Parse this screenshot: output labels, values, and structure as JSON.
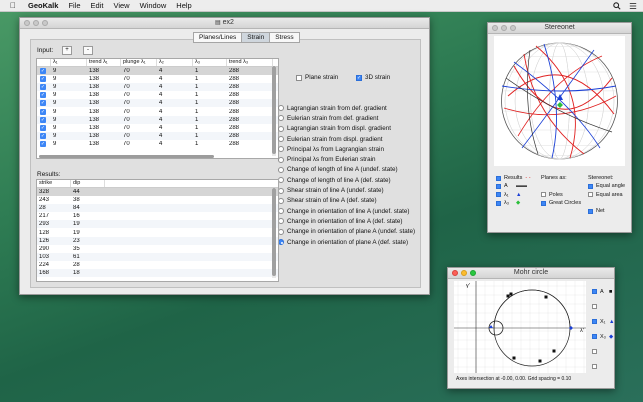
{
  "menubar": {
    "apple": "",
    "app": "GeoKalk",
    "items": [
      "File",
      "Edit",
      "View",
      "Window",
      "Help"
    ]
  },
  "main": {
    "title": "ex2",
    "tabs": [
      "Planes/Lines",
      "Strain",
      "Stress"
    ],
    "active_tab": "Strain",
    "input_label": "Input:",
    "add_label": "+",
    "remove_label": "-",
    "input_columns": [
      "",
      "λ₁",
      "trend λ₁",
      "plunge λ₁",
      "λ₂",
      "λ₃",
      "trend λ₃"
    ],
    "input_rows": [
      [
        "9",
        "138",
        "70",
        "4",
        "1",
        "288"
      ],
      [
        "9",
        "138",
        "70",
        "4",
        "1",
        "288"
      ],
      [
        "9",
        "138",
        "70",
        "4",
        "1",
        "288"
      ],
      [
        "9",
        "138",
        "70",
        "4",
        "1",
        "288"
      ],
      [
        "9",
        "138",
        "70",
        "4",
        "1",
        "288"
      ],
      [
        "9",
        "138",
        "70",
        "4",
        "1",
        "288"
      ],
      [
        "9",
        "138",
        "70",
        "4",
        "1",
        "288"
      ],
      [
        "9",
        "138",
        "70",
        "4",
        "1",
        "288"
      ],
      [
        "9",
        "138",
        "70",
        "4",
        "1",
        "288"
      ],
      [
        "9",
        "138",
        "70",
        "4",
        "1",
        "288"
      ]
    ],
    "plane_strain_label": "Plane strain",
    "strain3d_label": "3D strain",
    "options": [
      "Lagrangian strain from def. gradient",
      "Eulerian strain from def. gradient",
      "Lagrangian strain from displ. gradient",
      "Eulerian strain from displ. gradient",
      "Principal λs from Lagrangian strain",
      "Principal λs from Eulerian strain",
      "Change of length of line A (undef. state)",
      "Change of length of line A (def. state)",
      "Shear strain of line A (undef. state)",
      "Shear strain of line A (def. state)",
      "Change in orientation of line A (undef. state)",
      "Change in orientation of line A (def. state)",
      "Change in orientation of plane A (undef. state)",
      "Change in orientation of plane A (def. state)"
    ],
    "selected_option_index": 13,
    "results_label": "Results:",
    "results_columns": [
      "strike",
      "dip"
    ],
    "results_rows": [
      [
        "328",
        "44"
      ],
      [
        "243",
        "38"
      ],
      [
        "28",
        "84"
      ],
      [
        "217",
        "16"
      ],
      [
        "293",
        "19"
      ],
      [
        "128",
        "19"
      ],
      [
        "126",
        "23"
      ],
      [
        "290",
        "35"
      ],
      [
        "103",
        "61"
      ],
      [
        "224",
        "28"
      ],
      [
        "168",
        "18"
      ]
    ]
  },
  "stereonet": {
    "title": "Stereonet",
    "results_label": "Results",
    "legend": [
      {
        "label": "A",
        "color": "#444444"
      },
      {
        "label": "λ₁",
        "color": "#1a3fd6"
      },
      {
        "label": "λ₃",
        "color": "#2bbf3a"
      }
    ],
    "planes_as_label": "Planes as:",
    "poles_label": "Poles",
    "great_circles_label": "Great Circles",
    "stereonet_label": "Stereonet:",
    "equal_angle_label": "Equal angle",
    "equal_area_label": "Equal area",
    "net_label": "Net"
  },
  "mohr": {
    "title": "Mohr circle",
    "y_label": "γ'",
    "x_label": "λ'",
    "legend": [
      {
        "label": "A"
      },
      {
        "label": "X₁"
      },
      {
        "label": "X₃"
      }
    ],
    "note": "Axes intersection at -0.00, 0.00. Grid spacing = 0.10"
  },
  "colors": {
    "accent": "#3d86f6",
    "red_lines": "#e02020",
    "blue_lines": "#1a3fd6"
  }
}
